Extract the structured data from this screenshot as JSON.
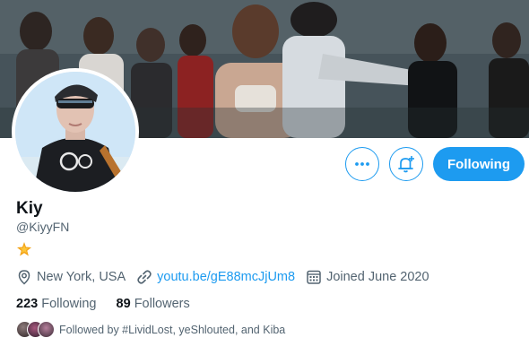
{
  "profile": {
    "name": "Kiy",
    "handle": "@KiyyFN",
    "location": "New York, USA",
    "website": "youtu.be/gE88mcJjUm8",
    "joined": "Joined June 2020"
  },
  "stats": {
    "following_count": "223",
    "following_label": "Following",
    "followers_count": "89",
    "followers_label": "Followers"
  },
  "actions": {
    "more_icon": "more-icon",
    "notifications_icon": "bell-plus-icon",
    "follow_label": "Following"
  },
  "followed_by": {
    "text": "Followed by #LividLost, yeShlouted, and Kiba"
  },
  "colors": {
    "accent": "#1d9bf0",
    "secondary_text": "#536471",
    "primary_text": "#0f1419"
  }
}
